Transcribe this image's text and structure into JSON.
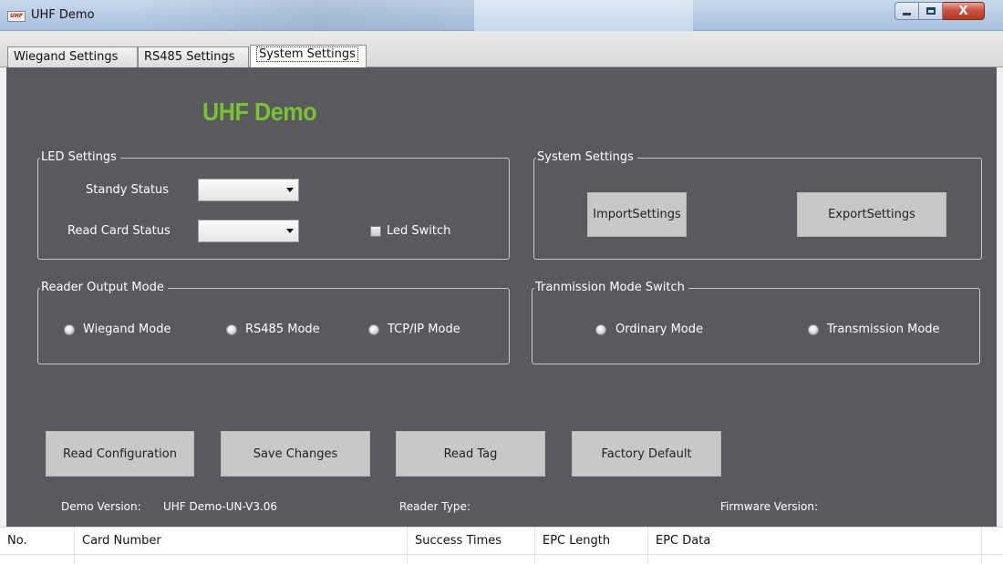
{
  "window": {
    "title": "UHF Demo",
    "icon_text": "UHF",
    "close_glyph": "X"
  },
  "tabs": [
    {
      "label": "Wiegand Settings",
      "active": false
    },
    {
      "label": "RS485 Settings",
      "active": false
    },
    {
      "label": "System Settings",
      "active": true
    }
  ],
  "brand": {
    "text": "UHF Demo",
    "color": "#79c232"
  },
  "led_settings": {
    "title": "LED Settings",
    "standby_label": "Standy Status",
    "standby_value": "",
    "read_card_label": "Read Card Status",
    "read_card_value": "",
    "led_switch_label": "Led Switch",
    "led_switch_checked": false
  },
  "system_settings": {
    "title": "System Settings",
    "import_label": "ImportSettings",
    "export_label": "ExportSettings"
  },
  "output_mode": {
    "title": "Reader Output Mode",
    "options": [
      "Wiegand Mode",
      "RS485 Mode",
      "TCP/IP Mode"
    ]
  },
  "transmission": {
    "title": "Tranmission Mode Switch",
    "options": [
      "Ordinary Mode",
      "Transmission Mode"
    ]
  },
  "actions": {
    "read_config": "Read Configuration",
    "save_changes": "Save Changes",
    "read_tag": "Read Tag",
    "factory_default": "Factory Default"
  },
  "info": {
    "demo_version_label": "Demo Version:",
    "demo_version_value": "UHF Demo-UN-V3.06",
    "reader_type_label": "Reader Type:",
    "reader_type_value": "",
    "firmware_label": "Firmware Version:",
    "firmware_value": ""
  },
  "grid": {
    "columns": [
      "No.",
      "Card Number",
      "Success Times",
      "EPC Length",
      "EPC Data"
    ]
  },
  "colors": {
    "panel_bg": "#595a5d",
    "button_bg": "#c8c8c8"
  }
}
